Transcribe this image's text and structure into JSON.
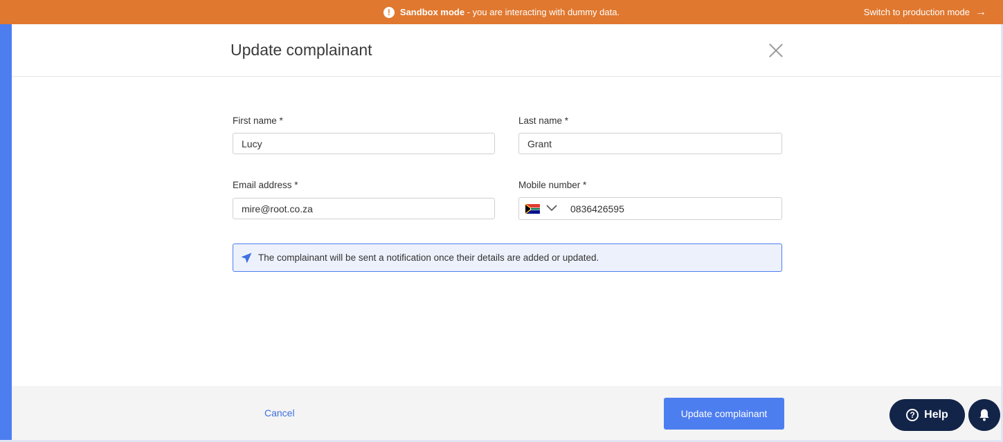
{
  "banner": {
    "warning_symbol": "!",
    "bold_text": "Sandbox mode",
    "text": " - you are interacting with dummy data.",
    "switch_label": "Switch to production mode",
    "arrow": "→",
    "color": "#e0782f"
  },
  "modal": {
    "title": "Update complainant",
    "close_icon": "close-icon"
  },
  "form": {
    "first_name": {
      "label": "First name *",
      "value": "Lucy"
    },
    "last_name": {
      "label": "Last name *",
      "value": "Grant"
    },
    "email": {
      "label": "Email address *",
      "value": "mire@root.co.za"
    },
    "mobile": {
      "label": "Mobile number *",
      "country_flag": "south-africa-flag-icon",
      "value": "0836426595"
    }
  },
  "notice": {
    "icon": "send-icon",
    "text": "The complainant will be sent a notification once their details are added or updated."
  },
  "footer": {
    "cancel_label": "Cancel",
    "submit_label": "Update complainant"
  },
  "help_widget": {
    "help_symbol": "?",
    "label": "Help",
    "notification_icon": "bell-icon"
  },
  "colors": {
    "accent": "#4d7ef0",
    "widget_dark": "#122448",
    "banner": "#e0782f"
  }
}
